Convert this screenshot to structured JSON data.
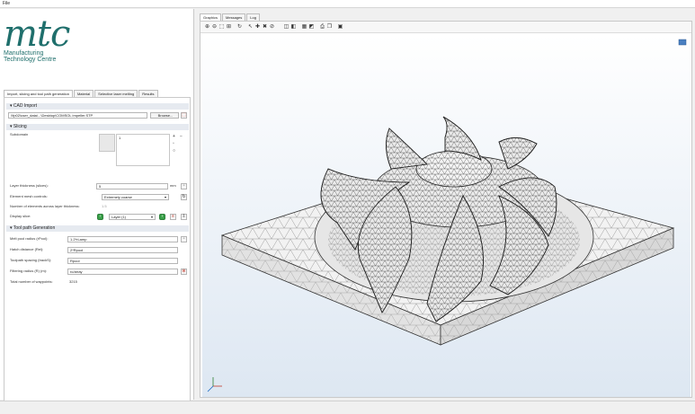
{
  "menubar": {
    "file_label": "File"
  },
  "logo": {
    "mark": "mtc",
    "line1": "Manufacturing",
    "line2": "Technology Centre"
  },
  "left_tabs": [
    {
      "label": "Import, slicing and tool path generation"
    },
    {
      "label": "Material"
    },
    {
      "label": "Selective laser melting"
    },
    {
      "label": "Results"
    }
  ],
  "cad_import": {
    "header": "CAD Import",
    "path_value": "\\\\fp02\\user_data\\...\\Desktop\\COMSOL impeller.STP",
    "browse_label": "Browse..."
  },
  "slicing": {
    "header": "Slicing",
    "subdomain_label": "Subdomain",
    "subdomain_list_item": "1",
    "layer_thickness_label": "Layer thickness (slices):",
    "layer_thickness_value": "5",
    "layer_thickness_unit": "mm",
    "mesh_controls_label": "Element mesh controls:",
    "mesh_controls_value": "Extremely coarse",
    "elements_across_label": "Number of elements across layer thickness:",
    "elements_across_value": "1.5",
    "display_slice_label": "Display slice:",
    "display_slice_value": "Layer (1)"
  },
  "toolpath": {
    "header": "Tool path Generation",
    "melt_pool_label": "Melt pool radius (rPool):",
    "melt_pool_value": "1.2*rLamp",
    "hatch_label": "Hatch distance (Rel):",
    "hatch_value": "2*Rpool",
    "toolpath_spacing_label": "Toolpath spacing (trackS):",
    "toolpath_spacing_value": "Rpool",
    "filtering_label": "Filtering radius (R) (m):",
    "filtering_value": "rc/array",
    "waypoints_label": "Total number of waypoints:",
    "waypoints_value": "3215"
  },
  "graphics_tabs": [
    {
      "label": "Graphics"
    },
    {
      "label": "Messages"
    },
    {
      "label": "Log"
    }
  ],
  "toolbar_icons": [
    "zoom-in-icon",
    "zoom-out-icon",
    "zoom-box-icon",
    "zoom-extents-icon",
    "rotate-icon",
    "select-icon",
    "add-select-icon",
    "remove-select-icon",
    "clear-select-icon",
    "wireframe-icon",
    "transparency-icon",
    "views-icon",
    "camera-icon",
    "print-icon",
    "copy-icon",
    "save-icon"
  ],
  "colors": {
    "brand": "#1f6f6c",
    "accent_green": "#3aa14a",
    "canvas_top": "#ffffff",
    "canvas_bottom": "#dde7f2"
  }
}
